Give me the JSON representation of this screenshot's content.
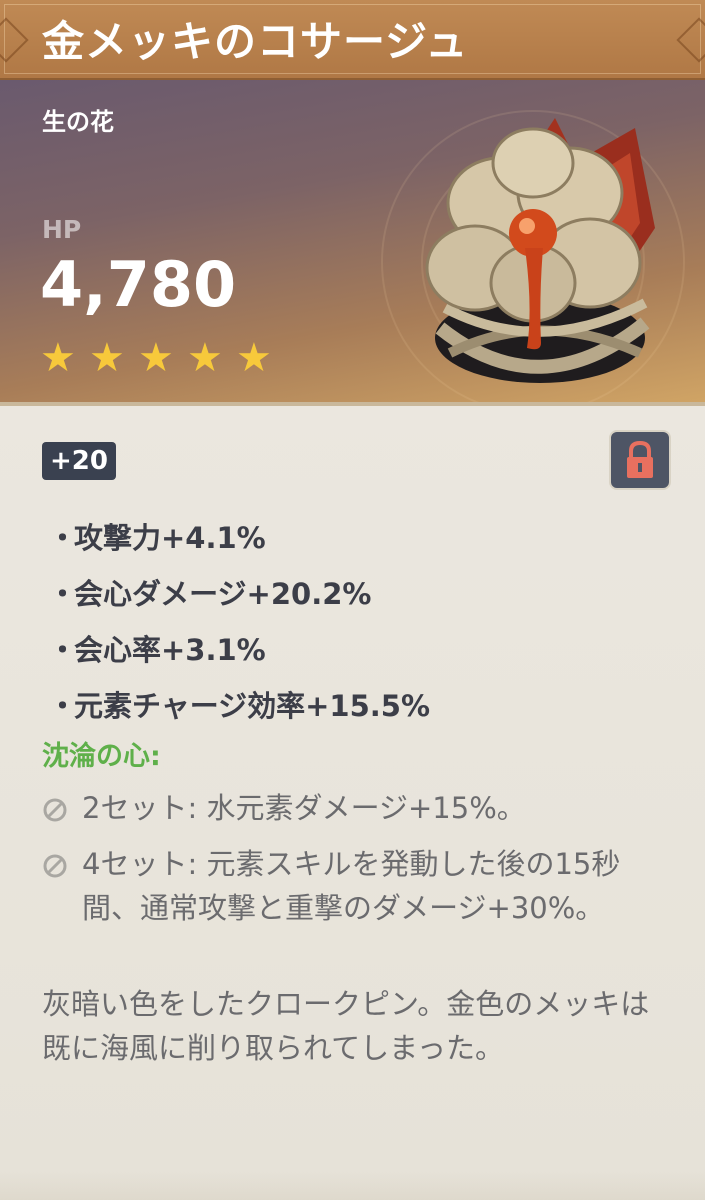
{
  "title": "金メッキのコサージュ",
  "slot_type": "生の花",
  "main_stat": {
    "label": "HP",
    "value": "4,780"
  },
  "rarity": {
    "stars": 5
  },
  "level": "+20",
  "locked": true,
  "substats": [
    {
      "bullet": "・",
      "text": "攻撃力+4.1%"
    },
    {
      "bullet": "・",
      "text": "会心ダメージ+20.2%"
    },
    {
      "bullet": "・",
      "text": "会心率+3.1%"
    },
    {
      "bullet": "・",
      "text": "元素チャージ効率+15.5%"
    }
  ],
  "set": {
    "name": "沈淪の心:",
    "effects": [
      {
        "icon": "disabled-circle-icon",
        "text": "2セット: 水元素ダメージ+15%。"
      },
      {
        "icon": "disabled-circle-icon",
        "text": "4セット: 元素スキルを発動した後の15秒間、通常攻撃と重撃のダメージ+30%。"
      }
    ]
  },
  "lore": "灰暗い色をしたクロークピン。金色のメッキは既に海風に削り取られてしまった。",
  "colors": {
    "title_bar": "#b07845",
    "star": "#f7c93b",
    "set_name": "#5fb04a",
    "lock_bg": "#4e5565",
    "lock_icon": "#e8705f",
    "badge_bg": "#3a4150"
  }
}
